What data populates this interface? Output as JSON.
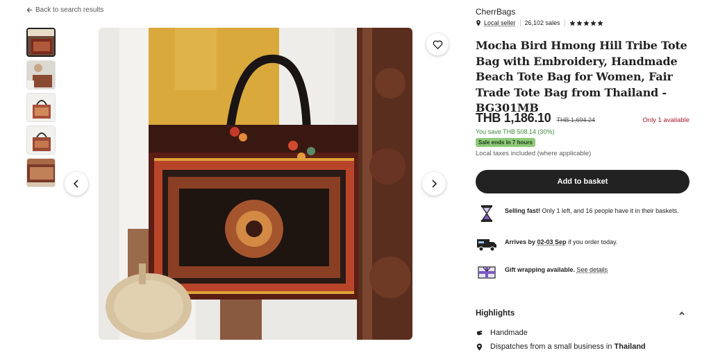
{
  "nav": {
    "back_label": "Back to search results"
  },
  "gallery": {
    "thumbnail_count": 5,
    "active_index": 0
  },
  "shop": {
    "name": "CherrBags",
    "badge": "Local seller",
    "sales": "26,102 sales",
    "rating_stars": 5
  },
  "product": {
    "title": "Mocha Bird Hmong Hill Tribe Tote Bag with Embroidery, Handmade Beach Tote Bag for Women, Fair Trade Tote Bag from Thailand - BG301MB",
    "price": "THB 1,186.10",
    "original_price": "THB 1,694.24",
    "availability": "Only 1 available",
    "you_save": "You save THB 508.14 (30%)",
    "sale_badge": "Sale ends in 7 hours",
    "taxes_note": "Local taxes included (where applicable)",
    "add_button": "Add to basket"
  },
  "features": {
    "selling_bold": "Selling fast!",
    "selling_rest": " Only 1 left, and 16 people have it in their baskets.",
    "arrives_prefix": "Arrives by ",
    "arrives_date": "02-03 Sep",
    "arrives_suffix": " if you order today.",
    "gift_bold": "Gift wrapping available.",
    "gift_link": "See details"
  },
  "highlights": {
    "heading": "Highlights",
    "handmade": "Handmade",
    "dispatch_prefix": "Dispatches from a small business in ",
    "dispatch_country": "Thailand"
  },
  "colors": {
    "dark_button": "#222222",
    "sale_green": "#8fc97a",
    "availability_red": "#a61a2e",
    "save_green": "#3e8b3e"
  }
}
